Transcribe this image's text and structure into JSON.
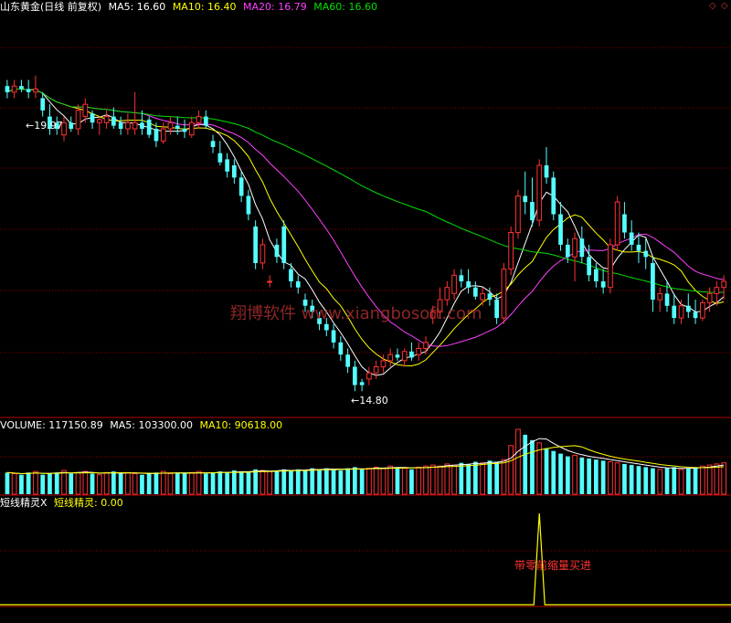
{
  "main_header": {
    "title": "山东黄金(日线 前复权)",
    "ma5": "MA5: 16.60",
    "ma10": "MA10: 16.40",
    "ma20": "MA20: 16.79",
    "ma60": "MA60: 16.60"
  },
  "volume_header": {
    "volume": "VOLUME: 117150.89",
    "ma5": "MA5: 103300.00",
    "ma10": "MA10: 90618.00"
  },
  "indicator_header": {
    "name": "短线精灵X",
    "value": "短线精灵: 0.00"
  },
  "annotations": {
    "high": "←19.97",
    "low": "←14.80",
    "signal": "带零前缩量买进"
  },
  "watermark": "翔博软件 www.xiangbosoft.com",
  "window_icons": [
    "◇",
    "◇"
  ],
  "colors": {
    "up": "#ff3232",
    "down": "#54ffff",
    "ma5": "#ffffff",
    "ma10": "#ffff00",
    "ma20": "#ff40ff",
    "ma60": "#00e000",
    "grid": "#8b0000"
  },
  "chart_data": [
    {
      "type": "candlestick",
      "price_range": [
        14.4,
        21.0
      ],
      "high_marker": 19.97,
      "low_marker": 14.8,
      "ohlc": [
        [
          19.8,
          19.9,
          19.6,
          19.7
        ],
        [
          19.7,
          19.9,
          19.6,
          19.8
        ],
        [
          19.8,
          19.9,
          19.7,
          19.75
        ],
        [
          19.75,
          19.9,
          19.6,
          19.7
        ],
        [
          19.7,
          19.97,
          19.6,
          19.75
        ],
        [
          19.6,
          19.7,
          19.3,
          19.4
        ],
        [
          19.3,
          19.5,
          19.0,
          19.1
        ],
        [
          19.2,
          19.3,
          19.0,
          19.1
        ],
        [
          19.0,
          19.3,
          18.9,
          19.2
        ],
        [
          19.2,
          19.3,
          19.05,
          19.1
        ],
        [
          19.1,
          19.5,
          19.0,
          19.4
        ],
        [
          19.3,
          19.6,
          19.2,
          19.5
        ],
        [
          19.35,
          19.4,
          19.1,
          19.2
        ],
        [
          19.2,
          19.3,
          19.0,
          19.25
        ],
        [
          19.2,
          19.4,
          19.1,
          19.3
        ],
        [
          19.3,
          19.45,
          19.1,
          19.15
        ],
        [
          19.2,
          19.3,
          19.0,
          19.1
        ],
        [
          19.1,
          19.35,
          19.0,
          19.2
        ],
        [
          19.1,
          19.7,
          19.0,
          19.2
        ],
        [
          19.2,
          19.4,
          19.0,
          19.1
        ],
        [
          19.25,
          19.3,
          18.95,
          19.0
        ],
        [
          19.1,
          19.2,
          18.8,
          18.9
        ],
        [
          18.9,
          19.2,
          18.85,
          19.1
        ],
        [
          19.1,
          19.3,
          19.0,
          19.2
        ],
        [
          19.15,
          19.3,
          19.0,
          19.1
        ],
        [
          19.1,
          19.25,
          18.95,
          19.05
        ],
        [
          19.0,
          19.3,
          18.95,
          19.2
        ],
        [
          19.2,
          19.4,
          19.1,
          19.3
        ],
        [
          19.3,
          19.4,
          19.1,
          19.15
        ],
        [
          18.9,
          19.0,
          18.7,
          18.8
        ],
        [
          18.7,
          18.9,
          18.5,
          18.55
        ],
        [
          18.6,
          18.7,
          18.3,
          18.4
        ],
        [
          18.5,
          18.6,
          18.2,
          18.3
        ],
        [
          18.3,
          18.4,
          17.9,
          18.0
        ],
        [
          18.0,
          18.1,
          17.6,
          17.7
        ],
        [
          17.5,
          17.6,
          16.8,
          16.9
        ],
        [
          16.9,
          17.3,
          16.8,
          17.2
        ],
        [
          16.6,
          16.7,
          16.5,
          16.6
        ],
        [
          17.2,
          17.3,
          16.9,
          17.0
        ],
        [
          17.5,
          17.6,
          16.8,
          16.9
        ],
        [
          16.8,
          16.9,
          16.5,
          16.6
        ],
        [
          16.6,
          16.7,
          16.4,
          16.5
        ],
        [
          16.3,
          16.4,
          16.1,
          16.2
        ],
        [
          16.2,
          16.3,
          16.0,
          16.1
        ],
        [
          16.0,
          16.1,
          15.8,
          15.9
        ],
        [
          15.9,
          16.0,
          15.7,
          15.8
        ],
        [
          15.8,
          15.9,
          15.5,
          15.6
        ],
        [
          15.6,
          15.7,
          15.3,
          15.4
        ],
        [
          15.4,
          15.5,
          15.1,
          15.2
        ],
        [
          15.2,
          15.3,
          14.8,
          14.9
        ],
        [
          14.95,
          15.0,
          14.8,
          14.9
        ],
        [
          15.0,
          15.2,
          14.9,
          15.1
        ],
        [
          15.1,
          15.3,
          15.0,
          15.2
        ],
        [
          15.2,
          15.4,
          15.1,
          15.3
        ],
        [
          15.3,
          15.5,
          15.2,
          15.4
        ],
        [
          15.4,
          15.5,
          15.3,
          15.35
        ],
        [
          15.3,
          15.5,
          15.2,
          15.45
        ],
        [
          15.45,
          15.6,
          15.3,
          15.35
        ],
        [
          15.4,
          15.6,
          15.3,
          15.5
        ],
        [
          15.5,
          15.7,
          15.4,
          15.6
        ],
        [
          16.0,
          16.2,
          15.9,
          16.1
        ],
        [
          16.1,
          16.5,
          16.0,
          16.3
        ],
        [
          16.3,
          16.6,
          16.2,
          16.5
        ],
        [
          16.4,
          16.8,
          16.3,
          16.7
        ],
        [
          16.7,
          16.8,
          16.5,
          16.6
        ],
        [
          16.6,
          16.8,
          16.4,
          16.5
        ],
        [
          16.5,
          16.6,
          16.3,
          16.35
        ],
        [
          16.3,
          16.5,
          16.2,
          16.4
        ],
        [
          16.4,
          16.5,
          16.2,
          16.3
        ],
        [
          16.3,
          16.4,
          15.9,
          16.0
        ],
        [
          16.0,
          16.9,
          15.9,
          16.8
        ],
        [
          16.8,
          17.5,
          16.7,
          17.4
        ],
        [
          17.4,
          18.1,
          17.3,
          18.0
        ],
        [
          18.0,
          18.4,
          17.7,
          17.9
        ],
        [
          17.9,
          18.3,
          17.5,
          17.6
        ],
        [
          17.6,
          18.6,
          17.5,
          18.5
        ],
        [
          18.5,
          18.8,
          18.2,
          18.3
        ],
        [
          18.3,
          18.4,
          17.6,
          17.7
        ],
        [
          17.7,
          17.9,
          17.1,
          17.2
        ],
        [
          17.2,
          17.3,
          16.9,
          17.0
        ],
        [
          17.0,
          17.4,
          16.6,
          17.3
        ],
        [
          17.3,
          17.5,
          16.9,
          17.0
        ],
        [
          17.0,
          17.2,
          16.6,
          16.7
        ],
        [
          16.8,
          16.9,
          16.5,
          16.6
        ],
        [
          16.6,
          16.8,
          16.4,
          16.5
        ],
        [
          16.5,
          17.3,
          16.4,
          17.2
        ],
        [
          17.2,
          18.0,
          17.1,
          17.9
        ],
        [
          17.7,
          17.9,
          17.3,
          17.4
        ],
        [
          17.4,
          17.6,
          17.1,
          17.2
        ],
        [
          17.2,
          17.4,
          16.9,
          17.1
        ],
        [
          17.1,
          17.3,
          16.8,
          17.0
        ],
        [
          16.9,
          17.0,
          16.1,
          16.3
        ],
        [
          16.3,
          16.5,
          16.1,
          16.4
        ],
        [
          16.4,
          16.6,
          16.1,
          16.2
        ],
        [
          16.2,
          16.4,
          15.9,
          16.0
        ],
        [
          16.0,
          16.3,
          15.9,
          16.2
        ],
        [
          16.2,
          16.4,
          16.0,
          16.1
        ],
        [
          16.1,
          16.3,
          15.9,
          16.0
        ],
        [
          16.0,
          16.3,
          15.95,
          16.25
        ],
        [
          16.25,
          16.5,
          16.1,
          16.4
        ],
        [
          16.4,
          16.6,
          16.2,
          16.5
        ],
        [
          16.5,
          16.7,
          16.3,
          16.6
        ]
      ]
    },
    {
      "type": "bar",
      "name": "VOLUME",
      "values": [
        40,
        38,
        36,
        40,
        42,
        36,
        38,
        40,
        44,
        38,
        40,
        42,
        38,
        36,
        40,
        42,
        38,
        40,
        38,
        36,
        38,
        40,
        42,
        38,
        40,
        38,
        40,
        42,
        38,
        40,
        42,
        40,
        44,
        42,
        40,
        46,
        44,
        42,
        44,
        46,
        44,
        46,
        44,
        48,
        46,
        48,
        46,
        44,
        48,
        50,
        46,
        48,
        50,
        48,
        52,
        50,
        48,
        46,
        50,
        52,
        54,
        52,
        56,
        54,
        58,
        56,
        60,
        58,
        62,
        60,
        64,
        90,
        120,
        110,
        100,
        95,
        85,
        80,
        75,
        70,
        72,
        68,
        66,
        64,
        62,
        60,
        58,
        56,
        54,
        52,
        50,
        48,
        46,
        48,
        50,
        46,
        48,
        50,
        52,
        54,
        56,
        58
      ]
    },
    {
      "type": "line",
      "name": "短线精灵",
      "signal_index": 75
    }
  ]
}
